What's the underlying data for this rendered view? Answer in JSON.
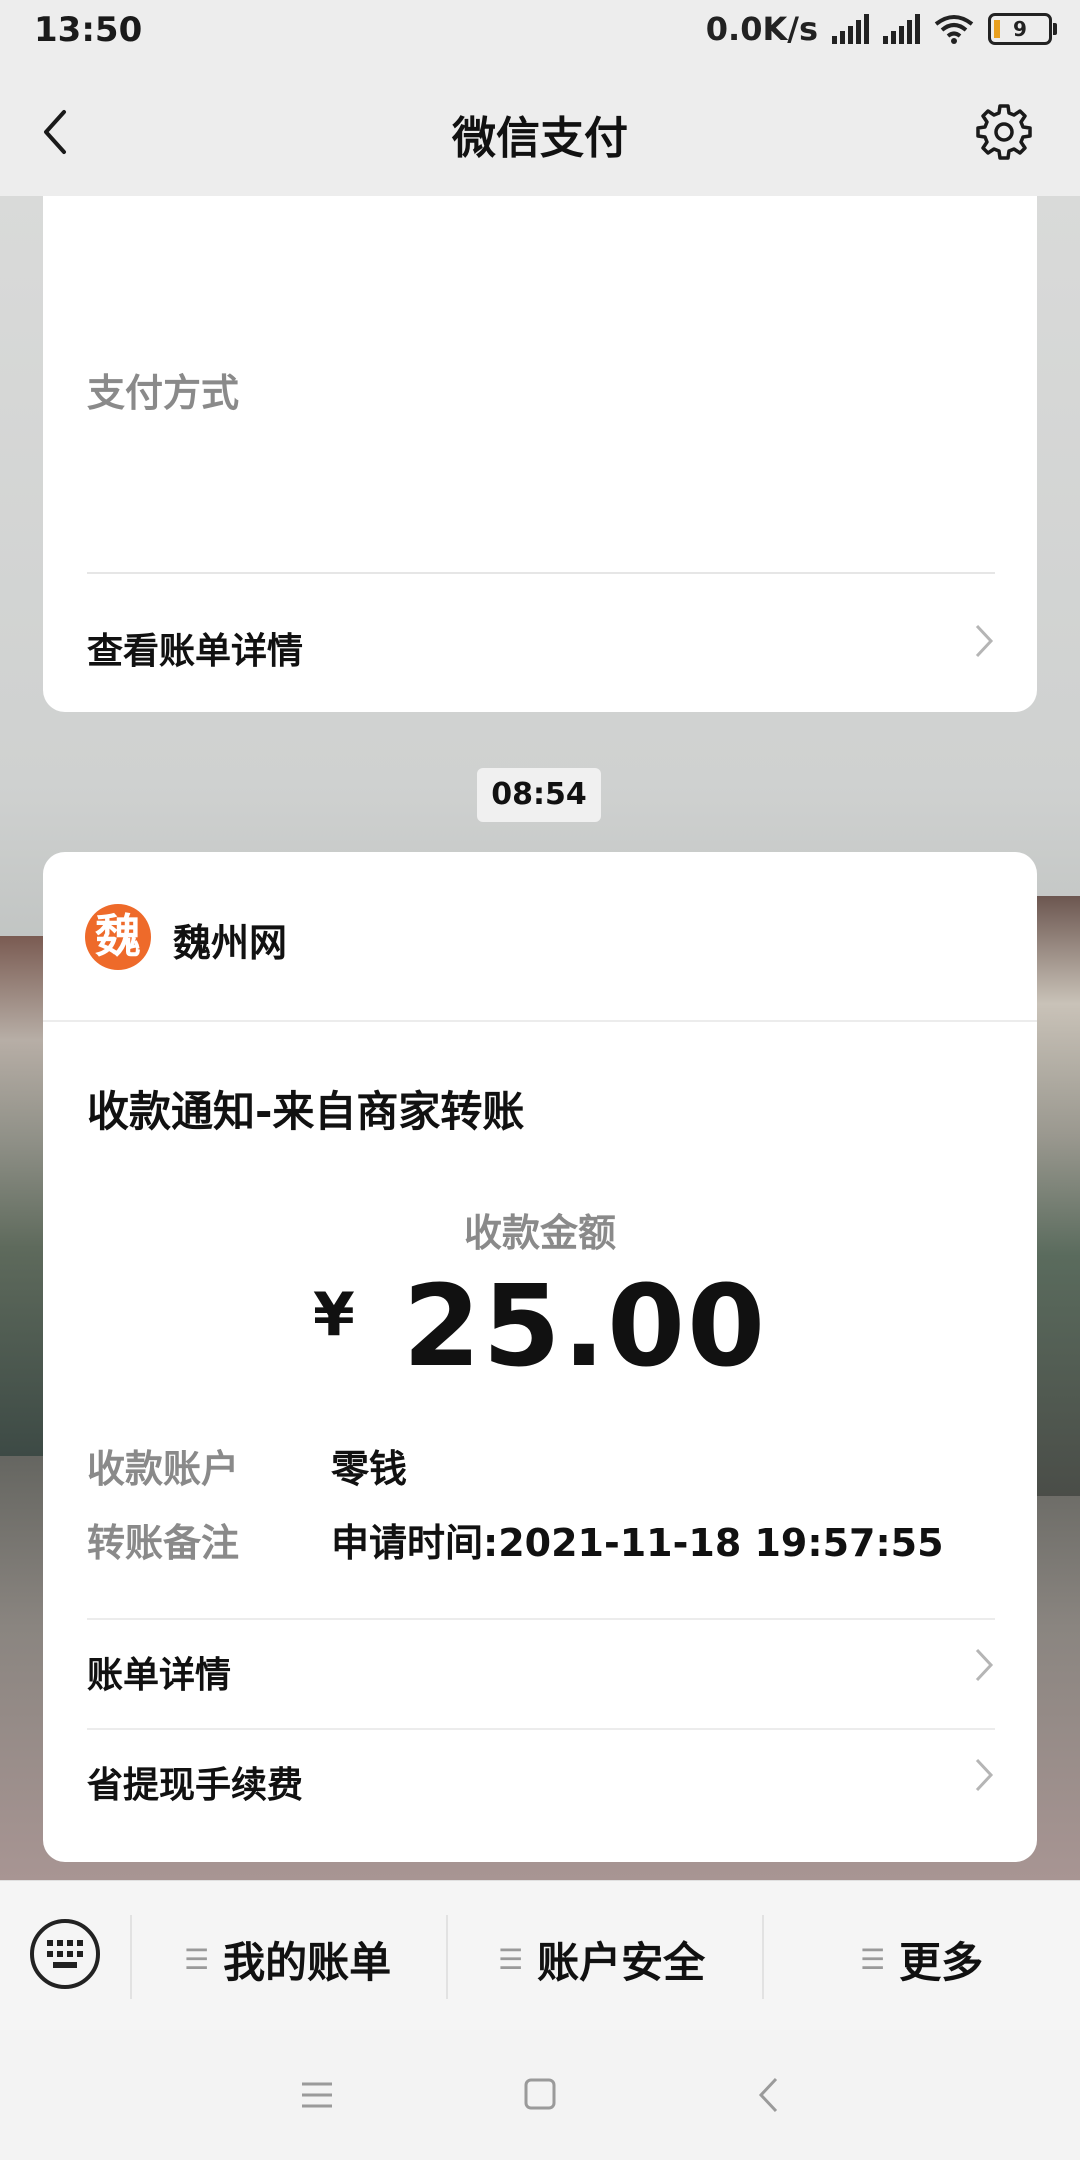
{
  "status_bar": {
    "time": "13:50",
    "net_speed": "0.0K/s",
    "battery": "9"
  },
  "header": {
    "title": "微信支付"
  },
  "card_top": {
    "pay_method_label": "支付方式",
    "view_bill_label": "查看账单详情"
  },
  "time_chip": "08:54",
  "card_main": {
    "source_name": "魏州网",
    "logo_char": "魏",
    "notice_title": "收款通知-来自商家转账",
    "amount_label": "收款金额",
    "currency": "¥",
    "amount": "25.00",
    "account_label": "收款账户",
    "account_value": "零钱",
    "remark_label": "转账备注",
    "remark_value": "申请时间:2021-11-18 19:57:55",
    "bill_detail_label": "账单详情",
    "save_fee_label": "省提现手续费"
  },
  "menu": {
    "item1": "我的账单",
    "item2": "账户安全",
    "item3": "更多"
  },
  "colors": {
    "logo": "#ee6a2a",
    "muted": "#8a8a8a"
  },
  "icons": [
    "back-icon",
    "settings-gear-icon",
    "chevron-right-icon",
    "keyboard-icon",
    "menu-lines-icon",
    "nav-menu-icon",
    "nav-home-icon",
    "nav-back-icon"
  ]
}
